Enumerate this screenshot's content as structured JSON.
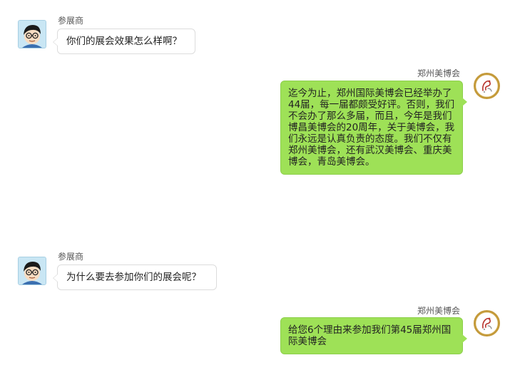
{
  "messages": [
    {
      "side": "left",
      "sender": "参展商",
      "text": "你们的展会效果怎么样啊？"
    },
    {
      "side": "right",
      "sender": "郑州美博会",
      "text": "迄今为止，郑州国际美博会已经举办了44届，每一届都颇受好评。否则，我们不会办了那么多届，而且，今年是我们博昌美博会的20周年，关于美博会，我们永远是认真负责的态度。我们不仅有郑州美博会，还有武汉美博会、重庆美博会，青岛美博会。"
    },
    {
      "side": "left",
      "sender": "参展商",
      "text": "为什么要去参加你们的展会呢？"
    },
    {
      "side": "right",
      "sender": "郑州美博会",
      "text": "给您6个理由来参加我们第45届郑州国际美博会"
    }
  ],
  "colors": {
    "right_bubble": "#9ee157",
    "left_bubble": "#ffffff",
    "brand_ring": "#c49a3a"
  },
  "icons": {
    "exhibitor_avatar": "cartoon-boy-with-glasses-icon",
    "organizer_avatar": "beauty-expo-logo-icon"
  }
}
